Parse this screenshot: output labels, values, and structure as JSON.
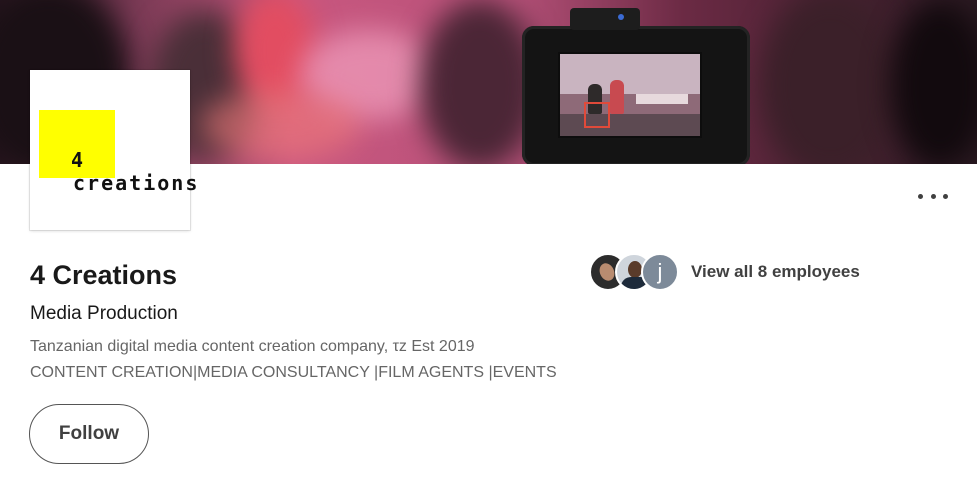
{
  "logo": {
    "number": "4",
    "word": "creations"
  },
  "company": {
    "name": "4 Creations",
    "industry": "Media Production",
    "tagline": "Tanzanian digital media content creation company, τz Est 2019",
    "services": "CONTENT CREATION|MEDIA CONSULTANCY |FILM AGENTS |EVENTS"
  },
  "actions": {
    "follow_label": "Follow"
  },
  "employees": {
    "label": "View all 8 employees",
    "avatars": [
      {
        "name": "avatar-photo-1"
      },
      {
        "name": "avatar-photo-2"
      },
      {
        "initial": "j"
      }
    ]
  },
  "colors": {
    "logo_accent": "#ffff00",
    "text_primary": "#191919",
    "text_secondary": "#666666"
  },
  "icons": {
    "menu": "more-horizontal-icon"
  }
}
